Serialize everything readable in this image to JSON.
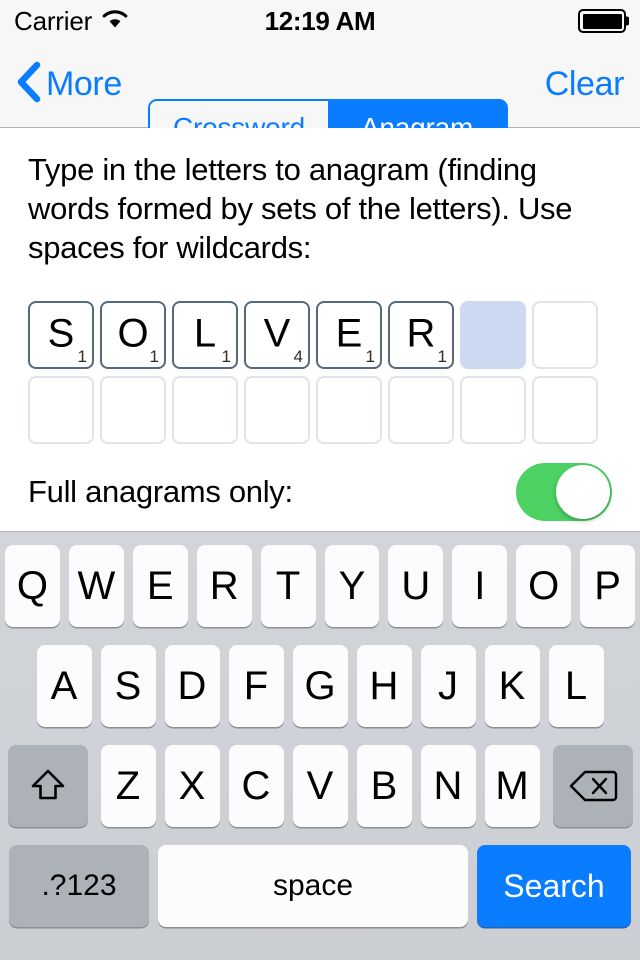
{
  "status_bar": {
    "carrier": "Carrier",
    "wifi_icon": "wifi-icon",
    "time": "12:19 AM",
    "battery_icon": "battery-full-icon"
  },
  "nav_bar": {
    "back_icon": "chevron-left-icon",
    "back_label": "More",
    "clear_label": "Clear",
    "segments": [
      {
        "label": "Crossword",
        "active": false
      },
      {
        "label": "Anagram",
        "active": true
      }
    ]
  },
  "content": {
    "instructions": "Type in the letters to anagram (finding words formed by sets of the letters). Use spaces for wildcards:",
    "tiles_row1": [
      {
        "letter": "S",
        "score": "1",
        "state": "filled"
      },
      {
        "letter": "O",
        "score": "1",
        "state": "filled"
      },
      {
        "letter": "L",
        "score": "1",
        "state": "filled"
      },
      {
        "letter": "V",
        "score": "4",
        "state": "filled"
      },
      {
        "letter": "E",
        "score": "1",
        "state": "filled"
      },
      {
        "letter": "R",
        "score": "1",
        "state": "filled"
      },
      {
        "letter": "",
        "score": "",
        "state": "cursor"
      },
      {
        "letter": "",
        "score": "",
        "state": "empty"
      }
    ],
    "tiles_row2": [
      {
        "letter": "",
        "score": "",
        "state": "empty"
      },
      {
        "letter": "",
        "score": "",
        "state": "empty"
      },
      {
        "letter": "",
        "score": "",
        "state": "empty"
      },
      {
        "letter": "",
        "score": "",
        "state": "empty"
      },
      {
        "letter": "",
        "score": "",
        "state": "empty"
      },
      {
        "letter": "",
        "score": "",
        "state": "empty"
      },
      {
        "letter": "",
        "score": "",
        "state": "empty"
      },
      {
        "letter": "",
        "score": "",
        "state": "empty"
      }
    ],
    "switch_label": "Full anagrams only:",
    "switch_on": true,
    "entered_word": "SOLVER"
  },
  "keyboard": {
    "row1": [
      "Q",
      "W",
      "E",
      "R",
      "T",
      "Y",
      "U",
      "I",
      "O",
      "P"
    ],
    "row2": [
      "A",
      "S",
      "D",
      "F",
      "G",
      "H",
      "J",
      "K",
      "L"
    ],
    "row3": [
      "Z",
      "X",
      "C",
      "V",
      "B",
      "N",
      "M"
    ],
    "shift_icon": "shift-arrow-icon",
    "delete_icon": "backspace-icon",
    "numbers_label": ".?123",
    "space_label": "space",
    "search_label": "Search"
  },
  "colors": {
    "accent_blue": "#0a7cff",
    "switch_green": "#4cd263",
    "tile_border_filled": "#56697c",
    "tile_border_empty": "#dfe3ea",
    "tile_cursor_fill": "#ccd9f0",
    "keyboard_bg": "#d2d5da",
    "bar_bg": "#f7f7f7"
  }
}
